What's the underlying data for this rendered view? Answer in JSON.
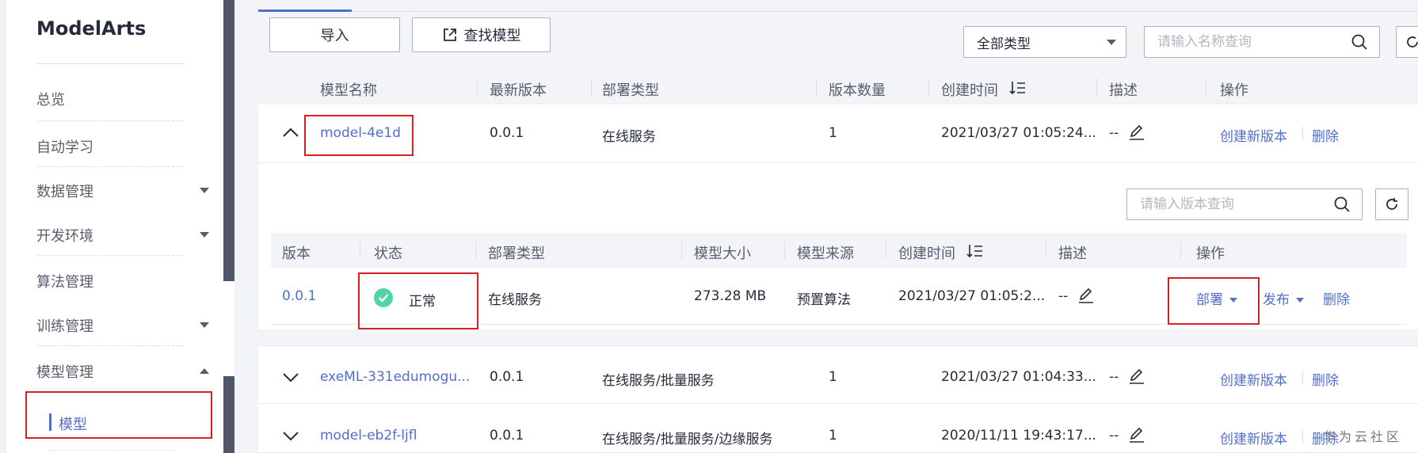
{
  "sidebar": {
    "brand": "ModelArts",
    "items": [
      {
        "label": "总览"
      },
      {
        "label": "自动学习"
      },
      {
        "label": "数据管理"
      },
      {
        "label": "开发环境"
      },
      {
        "label": "算法管理"
      },
      {
        "label": "训练管理"
      },
      {
        "label": "模型管理"
      }
    ],
    "active_item": "模型"
  },
  "toolbar": {
    "import_label": "导入",
    "find_model_label": "查找模型",
    "type_filter_value": "全部类型",
    "name_search_placeholder": "请输入名称查询"
  },
  "models_table": {
    "headers": [
      "模型名称",
      "最新版本",
      "部署类型",
      "版本数量",
      "创建时间",
      "描述",
      "操作"
    ],
    "rows": [
      {
        "name": "model-4e1d",
        "latest_version": "0.0.1",
        "deploy_type": "在线服务",
        "version_count": "1",
        "created": "2021/03/27 01:05:24...",
        "desc": "--",
        "action_create": "创建新版本",
        "action_delete": "删除"
      },
      {
        "name": "exeML-331edumogu...",
        "latest_version": "0.0.1",
        "deploy_type": "在线服务/批量服务",
        "version_count": "1",
        "created": "2021/03/27 01:04:33...",
        "desc": "--",
        "action_create": "创建新版本",
        "action_delete": "删除"
      },
      {
        "name": "model-eb2f-ljfl",
        "latest_version": "0.0.1",
        "deploy_type": "在线服务/批量服务/边缘服务",
        "version_count": "1",
        "created": "2020/11/11 19:43:17...",
        "desc": "--",
        "action_create": "创建新版本",
        "action_delete": "删除"
      }
    ]
  },
  "versions": {
    "search_placeholder": "请输入版本查询",
    "headers": [
      "版本",
      "状态",
      "部署类型",
      "模型大小",
      "模型来源",
      "创建时间",
      "描述",
      "操作"
    ],
    "row": {
      "version": "0.0.1",
      "status": "正常",
      "deploy_type": "在线服务",
      "size": "273.28 MB",
      "source": "预置算法",
      "created": "2021/03/27 01:05:2...",
      "desc": "--",
      "action_deploy": "部署",
      "action_publish": "发布",
      "action_delete": "删除"
    }
  },
  "watermark": "华为云社区",
  "colors": {
    "accent": "#526ecc",
    "highlight": "#d71f26",
    "status_ok": "#50d4ab",
    "splitter": "#50576a"
  }
}
